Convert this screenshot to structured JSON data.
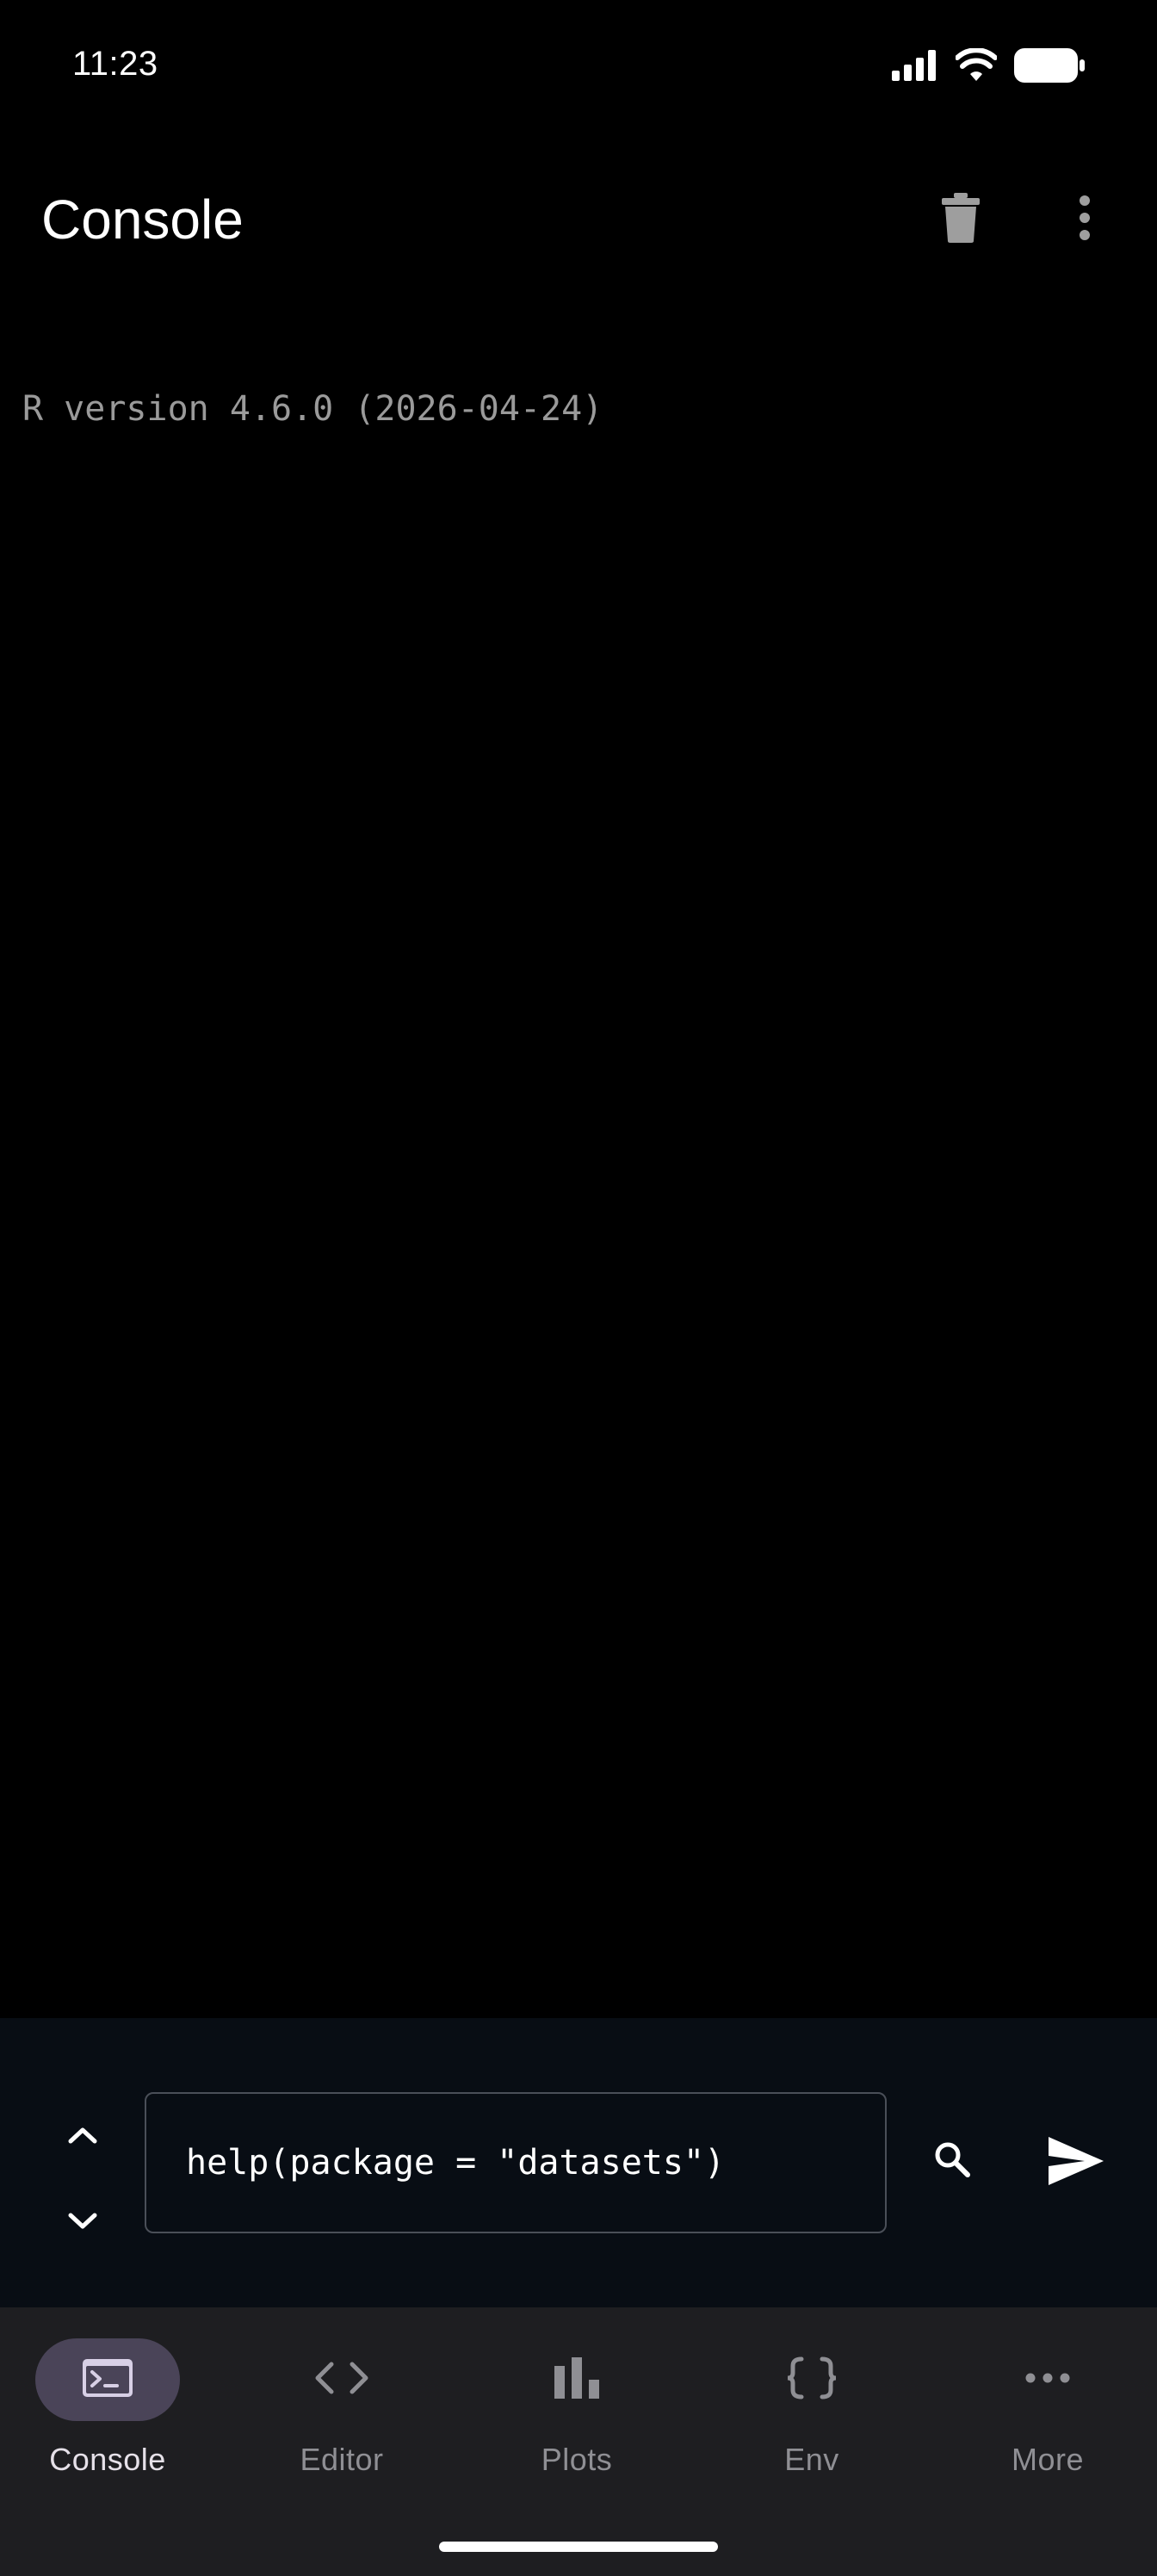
{
  "status_bar": {
    "time": "11:23",
    "icons": [
      "signal-icon",
      "wifi-icon",
      "battery-icon"
    ]
  },
  "app_bar": {
    "title": "Console",
    "actions": [
      "delete-icon",
      "more-vert-icon"
    ]
  },
  "console": {
    "lines": [
      "R version 4.6.0 (2026-04-24)"
    ]
  },
  "input": {
    "value": "help(package = \"datasets\")",
    "history_up_icon": "chevron-up-icon",
    "history_down_icon": "chevron-down-icon",
    "search_icon": "search-icon",
    "send_icon": "send-icon"
  },
  "bottom_nav": {
    "items": [
      {
        "label": "Console",
        "icon": "terminal-icon",
        "active": true
      },
      {
        "label": "Editor",
        "icon": "code-icon",
        "active": false
      },
      {
        "label": "Plots",
        "icon": "bar-chart-icon",
        "active": false
      },
      {
        "label": "Env",
        "icon": "braces-icon",
        "active": false
      },
      {
        "label": "More",
        "icon": "more-horiz-icon",
        "active": false
      }
    ]
  },
  "colors": {
    "background": "#000000",
    "input_area": "#080d14",
    "nav_background": "#1e1e21",
    "active_pill": "#4a4458",
    "muted_text": "#9a9a9a"
  }
}
